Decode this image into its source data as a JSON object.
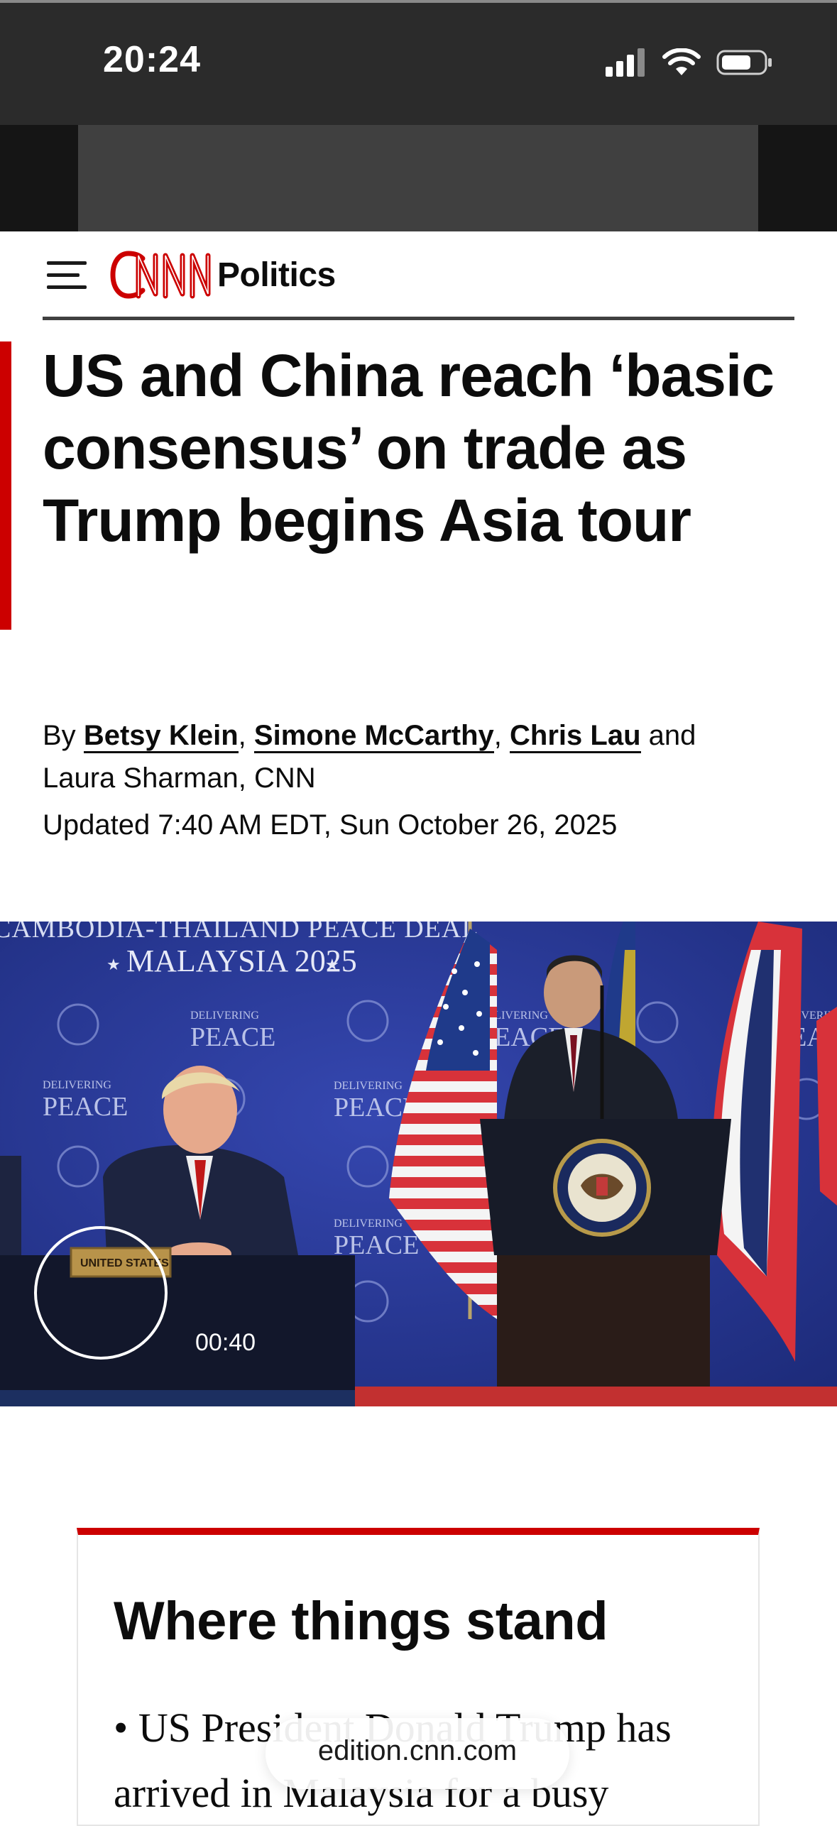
{
  "status_bar": {
    "time": "20:24"
  },
  "header": {
    "section": "Politics"
  },
  "article": {
    "headline": "US and China reach ‘basic consensus’ on trade as Trump begins Asia tour",
    "byline": {
      "prefix": "By",
      "authors_linked": [
        "Betsy Klein",
        "Simone McCarthy",
        "Chris Lau"
      ],
      "separator": ",",
      "and": "and",
      "author_rest": "Laura Sharman, CNN"
    },
    "updated": "Updated 7:40 AM EDT, Sun October 26, 2025"
  },
  "video": {
    "duration": "00:40",
    "banner_text": "CAMBODIA-THAILAND PEACE DEAL",
    "banner_subtitle": "MALAYSIA 2025",
    "backdrop_small": "DELIVERING",
    "backdrop_large": "PEACE",
    "nameplate": "UNITED STATES"
  },
  "summary_box": {
    "title": "Where things stand",
    "bullet": "•",
    "text": "US President Donald Trump has arrived in Malaysia for a busy"
  },
  "browser": {
    "url": "edition.cnn.com"
  },
  "colors": {
    "cnn_red": "#cc0000",
    "status_bar_bg": "#2b2b2b",
    "backdrop_blue": "#2a3c9a"
  }
}
